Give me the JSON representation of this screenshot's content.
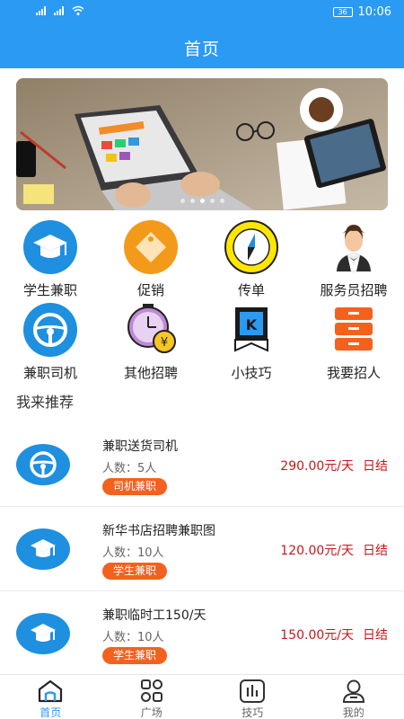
{
  "status": {
    "time": "10:06",
    "battery": "36"
  },
  "header": {
    "title": "首页"
  },
  "categories": [
    {
      "label": "学生兼职",
      "icon": "graduation-cap-icon"
    },
    {
      "label": "促销",
      "icon": "price-tag-icon"
    },
    {
      "label": "传单",
      "icon": "compass-icon"
    },
    {
      "label": "服务员招聘",
      "icon": "waiter-icon"
    },
    {
      "label": "兼职司机",
      "icon": "steering-wheel-icon"
    },
    {
      "label": "其他招聘",
      "icon": "clock-yen-icon"
    },
    {
      "label": "小技巧",
      "icon": "bookmark-k-icon"
    },
    {
      "label": "我要招人",
      "icon": "drawer-cabinet-icon"
    }
  ],
  "section": {
    "title": "我来推荐"
  },
  "jobs": [
    {
      "title": "兼职送货司机",
      "count": "人数：5人",
      "tag": "司机兼职",
      "pay": "290.00元/天",
      "settle": "日结",
      "icon": "steering-wheel-icon"
    },
    {
      "title": "新华书店招聘兼职图",
      "count": "人数：10人",
      "tag": "学生兼职",
      "pay": "120.00元/天",
      "settle": "日结",
      "icon": "graduation-cap-icon"
    },
    {
      "title": "兼职临时工150/天",
      "count": "人数：10人",
      "tag": "学生兼职",
      "pay": "150.00元/天",
      "settle": "日结",
      "icon": "graduation-cap-icon"
    }
  ],
  "nav": [
    {
      "label": "首页",
      "icon": "home-icon",
      "active": true
    },
    {
      "label": "广场",
      "icon": "grid-icon",
      "active": false
    },
    {
      "label": "技巧",
      "icon": "chart-icon",
      "active": false
    },
    {
      "label": "我的",
      "icon": "user-icon",
      "active": false
    }
  ],
  "colors": {
    "primary": "#2b9af3",
    "tag": "#f4611f",
    "price": "#c8161d"
  }
}
